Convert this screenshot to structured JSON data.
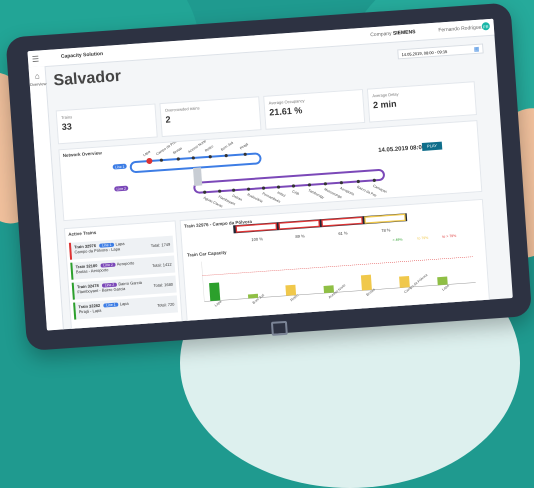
{
  "app": {
    "title": "Capacity Solution",
    "company_label": "Company",
    "company_name": "SIEMENS",
    "user": "Fernando Rodriguez",
    "avatar": "FR"
  },
  "sidebar": {
    "items": [
      {
        "icon": "home-icon",
        "label": "Overview"
      }
    ]
  },
  "page": {
    "title": "Salvador"
  },
  "date_selector": {
    "value": "14.05.2019, 08:00 - 09:15"
  },
  "kpis": [
    {
      "label": "Trains",
      "value": "33"
    },
    {
      "label": "Overcrowded trains",
      "value": "2"
    },
    {
      "label": "Average Occupancy",
      "value": "21.61 %"
    },
    {
      "label": "Average Delay",
      "value": "2 min"
    }
  ],
  "network": {
    "title": "Network Overview",
    "datetime": "14.05.2019 08:00:00",
    "play_label": "PLAY",
    "lines": [
      {
        "name": "Line 1",
        "color": "#3d7de5"
      },
      {
        "name": "Line 2",
        "color": "#7b48b8"
      }
    ],
    "stations_top": [
      "Lapa",
      "Campo da Pólvora",
      "Brotas",
      "Acesso Norte",
      "Retiro",
      "Bom Juá",
      "Pirajá"
    ],
    "stations_bottom": [
      "Aguas Claras",
      "Flamboyant",
      "Detran",
      "Rodoviária",
      "Pernambués",
      "Imbuí",
      "CAB",
      "Tamburugy",
      "Mussurunga",
      "Aeroporto",
      "Bairro da Paz",
      "Camaçari"
    ]
  },
  "active_trains": {
    "title": "Active Trains",
    "items": [
      {
        "name": "Train 32976",
        "line": "Line 1",
        "line_color": "blue",
        "dest": "Lapa",
        "route": "Campo da Pólvora - Lapa",
        "total": "Total: 1749",
        "status": "red"
      },
      {
        "name": "Train 32180",
        "line": "Line 2",
        "line_color": "purple",
        "dest": "Aeroporto",
        "route": "Brotas - Aeroporto",
        "total": "Total: 1412",
        "status": "green"
      },
      {
        "name": "Train 32478",
        "line": "Line 2",
        "line_color": "purple",
        "dest": "Bairro Garcia",
        "route": "Flamboyant - Bairro Garcia",
        "total": "Total: 1680",
        "status": "green"
      },
      {
        "name": "Train 32282",
        "line": "Line 1",
        "line_color": "blue",
        "dest": "Lapa",
        "route": "Pirajá - Lapa",
        "total": "Total: 720",
        "status": "green"
      }
    ]
  },
  "train_detail": {
    "title": "Train 32976 - Campo da Pólvora",
    "car_labels": [
      "100 %",
      "89 %",
      "61 %",
      "78 %"
    ],
    "chart_title": "Train Car Capacity",
    "legend": [
      "< 49%",
      "to 79%",
      "to > 79%"
    ]
  },
  "chart_data": {
    "type": "bar",
    "categories": [
      "Lapa",
      "Bom Juá",
      "Retiro",
      "Acesso Norte",
      "Brotas",
      "Campo da Pólvora",
      "Lapa"
    ],
    "series": [
      {
        "values": [
          45,
          10,
          26,
          18,
          38,
          28,
          20
        ]
      }
    ],
    "ylim": [
      0,
      100
    ]
  },
  "colors": {
    "screen_bg": "#f4f6f8",
    "teal": "#19b6a8",
    "blue": "#3d7de5",
    "purple": "#7b48b8",
    "red": "#d33",
    "green": "#2ca02c",
    "yellow": "#f0c84b"
  }
}
